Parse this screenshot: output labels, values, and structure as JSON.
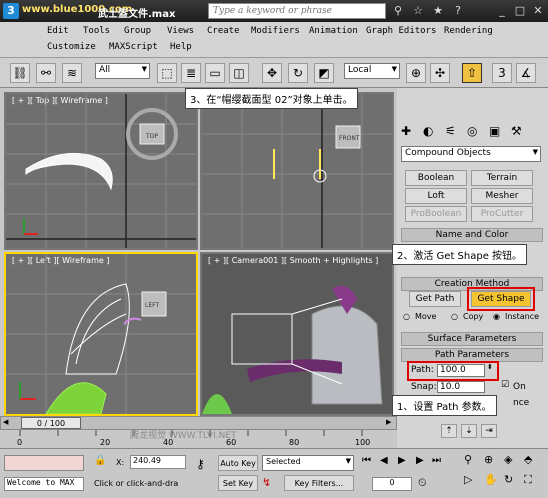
{
  "titlebar": {
    "watermark": "www.blue1000.com",
    "title": "武士盔文件.max",
    "search_placeholder": "Type a keyword or phrase"
  },
  "menu": {
    "row1": [
      "Edit",
      "Tools",
      "Group",
      "Views",
      "Create",
      "Modifiers",
      "Animation",
      "Graph Editors",
      "Rendering"
    ],
    "row2": [
      "Customize",
      "MAXScript",
      "Help"
    ]
  },
  "toolbar": {
    "selection_filter": "All",
    "coord_system": "Local"
  },
  "viewports": {
    "top": "[ + ][ Top ][ Wireframe ]",
    "front": "FRONT",
    "left": "[ + ][ Left ][ Wireframe ]",
    "camera": "[ + ][ Camera001 ][ Smooth + Highlights ]",
    "top_cube": "TOP",
    "left_cube": "LEFT"
  },
  "command_panel": {
    "category": "Compound Objects",
    "buttons": [
      {
        "label": "Boolean",
        "enabled": true
      },
      {
        "label": "Terrain",
        "enabled": true
      },
      {
        "label": "Loft",
        "enabled": true
      },
      {
        "label": "Mesher",
        "enabled": true
      },
      {
        "label": "ProBoolean",
        "enabled": false
      },
      {
        "label": "ProCutter",
        "enabled": false
      }
    ],
    "rollout_name_color": "Name and Color",
    "rollout_creation": "Creation Method",
    "get_path": "Get Path",
    "get_shape": "Get Shape",
    "move": "Move",
    "copy": "Copy",
    "instance": "Instance",
    "rollout_surface": "Surface Parameters",
    "rollout_path": "Path Parameters",
    "path_label": "Path:",
    "path_value": "100.0",
    "snap_label": "Snap:",
    "snap_value": "10.0",
    "on": "On",
    "distance_partial": "nce"
  },
  "callouts": {
    "c1": "1、设置 Path 参数。",
    "c2": "2、激活 Get Shape 按钮。",
    "c3": "3、在“帽缨截面型 02”对象上单击。"
  },
  "timeline": {
    "frame": "0 / 100",
    "ticks": [
      "0",
      "20",
      "40",
      "60",
      "80",
      "100"
    ]
  },
  "statusbar": {
    "welcome": "Welcome to MAX",
    "prompt": "Click or click-and-dra",
    "x_label": "X:",
    "x_value": "240.49",
    "auto_key": "Auto Key",
    "selected": "Selected",
    "set_key": "Set Key",
    "key_filters": "Key Filters...",
    "frame_field": "0",
    "watermark": "腾龙视觉 WWW.TLVI.NET"
  }
}
